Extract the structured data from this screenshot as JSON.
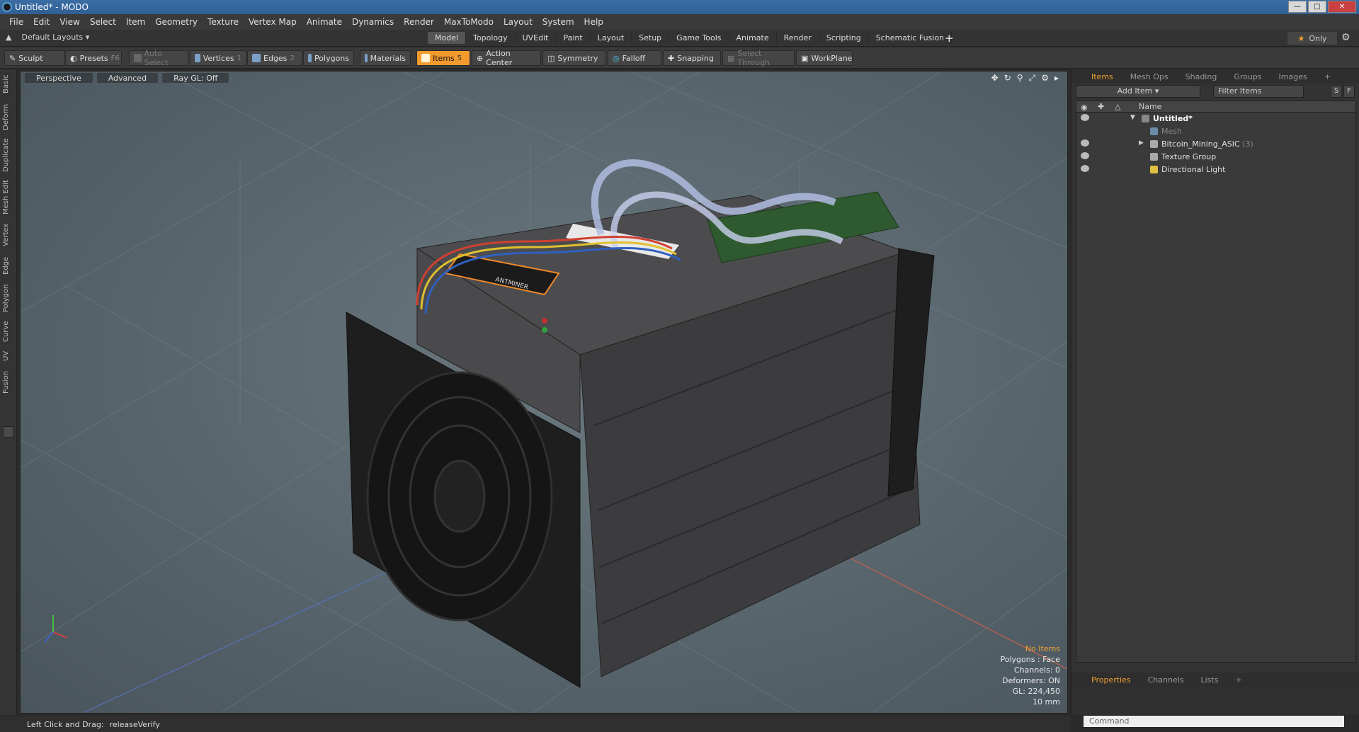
{
  "window": {
    "title": "Untitled* - MODO"
  },
  "menu": [
    "File",
    "Edit",
    "View",
    "Select",
    "Item",
    "Geometry",
    "Texture",
    "Vertex Map",
    "Animate",
    "Dynamics",
    "Render",
    "MaxToModo",
    "Layout",
    "System",
    "Help"
  ],
  "layouts": {
    "label": "Default Layouts"
  },
  "layout_tabs": [
    "Model",
    "Topology",
    "UVEdit",
    "Paint",
    "Layout",
    "Setup",
    "Game Tools",
    "Animate",
    "Render",
    "Scripting",
    "Schematic Fusion"
  ],
  "only_label": "Only",
  "toolbar": {
    "sculpt": "Sculpt",
    "presets": "Presets",
    "presets_key": "F6",
    "auto_select": "Auto Select",
    "vertices": "Vertices",
    "vertices_key": "1",
    "edges": "Edges",
    "edges_key": "2",
    "polygons": "Polygons",
    "materials": "Materials",
    "items": "Items",
    "items_key": "5",
    "action_center": "Action Center",
    "symmetry": "Symmetry",
    "falloff": "Falloff",
    "snapping": "Snapping",
    "select_through": "Select Through",
    "workplane": "WorkPlane"
  },
  "left_tabs": [
    "Basic",
    "Deform",
    "Duplicate",
    "Mesh Edit",
    "Vertex",
    "Edge",
    "Polygon",
    "Curve",
    "UV",
    "Fusion"
  ],
  "viewport": {
    "header": [
      "Perspective",
      "Advanced",
      "Ray GL: Off"
    ],
    "hud": {
      "items": "No Items",
      "polygons": "Polygons : Face",
      "channels": "Channels: 0",
      "deformers": "Deformers: ON",
      "gl": "GL: 224,450",
      "scale": "10 mm"
    },
    "label_brand": "ANTMINER"
  },
  "right_panel": {
    "tabs": [
      "Items",
      "Mesh Ops",
      "Shading",
      "Groups",
      "Images"
    ],
    "add_item": "Add Item",
    "filter_items": "Filter Items",
    "s_btn": "S",
    "f_btn": "F",
    "col_name": "Name",
    "items": [
      {
        "name": "Untitled*",
        "count": ""
      },
      {
        "name": "Mesh",
        "count": ""
      },
      {
        "name": "Bitcoin_Mining_ASIC",
        "count": "(3)"
      },
      {
        "name": "Texture Group",
        "count": ""
      },
      {
        "name": "Directional Light",
        "count": ""
      }
    ],
    "bottom_tabs": [
      "Properties",
      "Channels",
      "Lists"
    ],
    "command_placeholder": "Command"
  },
  "status": {
    "left": "Left Click and Drag:",
    "action": "releaseVerify"
  }
}
